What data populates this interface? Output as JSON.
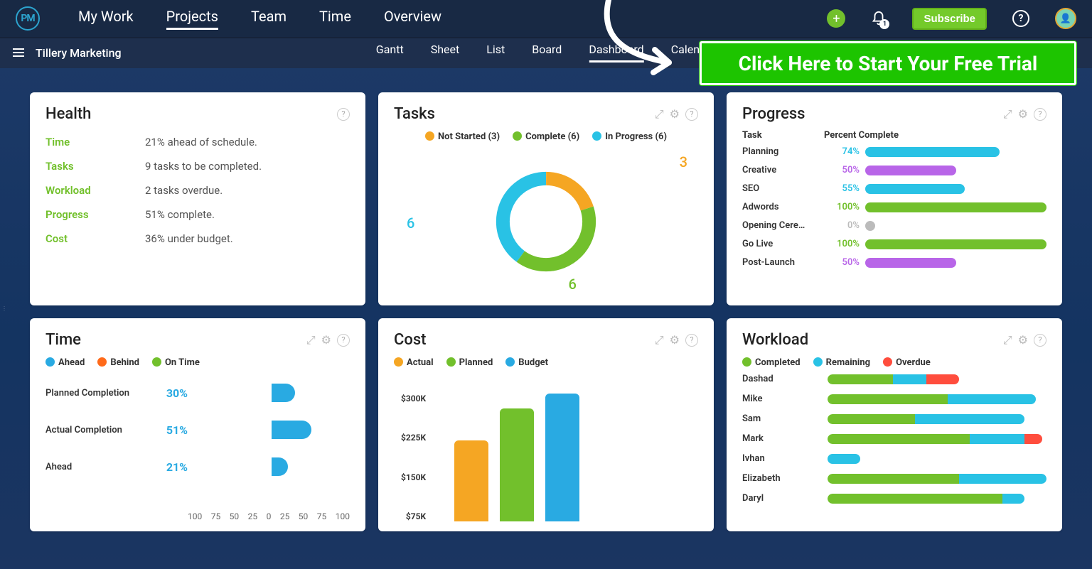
{
  "nav": {
    "logo": "PM",
    "items": [
      "My Work",
      "Projects",
      "Team",
      "Time",
      "Overview"
    ],
    "active_index": 1,
    "subscribe_label": "Subscribe",
    "bell_count": "1"
  },
  "project": {
    "name": "Tillery Marketing"
  },
  "view_tabs": {
    "items": [
      "Gantt",
      "Sheet",
      "List",
      "Board",
      "Dashboard",
      "Calendar"
    ],
    "active_index": 4
  },
  "cta": {
    "label": "Click Here to Start Your Free Trial"
  },
  "cards": {
    "health": {
      "title": "Health",
      "rows": [
        {
          "label": "Time",
          "value": "21% ahead of schedule."
        },
        {
          "label": "Tasks",
          "value": "9 tasks to be completed."
        },
        {
          "label": "Workload",
          "value": "2 tasks overdue."
        },
        {
          "label": "Progress",
          "value": "51% complete."
        },
        {
          "label": "Cost",
          "value": "36% under budget."
        }
      ]
    },
    "tasks": {
      "title": "Tasks",
      "legend": [
        {
          "label": "Not Started (3)",
          "color": "#f5a623",
          "count": 3
        },
        {
          "label": "Complete (6)",
          "color": "#72c02c",
          "count": 6
        },
        {
          "label": "In Progress (6)",
          "color": "#29c2e5",
          "count": 6
        }
      ],
      "donut_labels": {
        "top": "3",
        "bottom": "6",
        "left": "6"
      }
    },
    "progress": {
      "title": "Progress",
      "header_task": "Task",
      "header_pct": "Percent Complete",
      "rows": [
        {
          "task": "Planning",
          "pct": "74%",
          "pctn": 74,
          "color": "#29c2e5"
        },
        {
          "task": "Creative",
          "pct": "50%",
          "pctn": 50,
          "color": "#b865e8"
        },
        {
          "task": "SEO",
          "pct": "55%",
          "pctn": 55,
          "color": "#29c2e5"
        },
        {
          "task": "Adwords",
          "pct": "100%",
          "pctn": 100,
          "color": "#72c02c"
        },
        {
          "task": "Opening Cere…",
          "pct": "0%",
          "pctn": 0,
          "color": "#bbbbbb"
        },
        {
          "task": "Go Live",
          "pct": "100%",
          "pctn": 100,
          "color": "#72c02c"
        },
        {
          "task": "Post-Launch",
          "pct": "50%",
          "pctn": 50,
          "color": "#b865e8"
        }
      ]
    },
    "time": {
      "title": "Time",
      "legend": [
        {
          "label": "Ahead",
          "color": "#29aae2"
        },
        {
          "label": "Behind",
          "color": "#ff6a1a"
        },
        {
          "label": "On Time",
          "color": "#72c02c"
        }
      ],
      "rows": [
        {
          "label": "Planned Completion",
          "value": "30%",
          "n": 30
        },
        {
          "label": "Actual Completion",
          "value": "51%",
          "n": 51
        },
        {
          "label": "Ahead",
          "value": "21%",
          "n": 21
        }
      ],
      "xaxis": [
        "100",
        "75",
        "50",
        "25",
        "0",
        "25",
        "50",
        "75",
        "100"
      ]
    },
    "cost": {
      "title": "Cost",
      "legend": [
        {
          "label": "Actual",
          "color": "#f5a623"
        },
        {
          "label": "Planned",
          "color": "#72c02c"
        },
        {
          "label": "Budget",
          "color": "#29aae2"
        }
      ],
      "ylabels": [
        "$300K",
        "$225K",
        "$150K",
        "$75K"
      ],
      "bars": [
        {
          "name": "Actual",
          "value": 190,
          "color": "#f5a623"
        },
        {
          "name": "Planned",
          "value": 265,
          "color": "#72c02c"
        },
        {
          "name": "Budget",
          "value": 300,
          "color": "#29aae2"
        }
      ],
      "ymax": 300
    },
    "workload": {
      "title": "Workload",
      "legend": [
        {
          "label": "Completed",
          "color": "#72c02c"
        },
        {
          "label": "Remaining",
          "color": "#29c2e5"
        },
        {
          "label": "Overdue",
          "color": "#ff4d3d"
        }
      ],
      "rows": [
        {
          "name": "Dashad",
          "seg": [
            30,
            15,
            15
          ],
          "total": 100
        },
        {
          "name": "Mike",
          "seg": [
            55,
            40,
            0
          ],
          "total": 100
        },
        {
          "name": "Sam",
          "seg": [
            40,
            50,
            0
          ],
          "total": 100
        },
        {
          "name": "Mark",
          "seg": [
            65,
            25,
            8
          ],
          "total": 100
        },
        {
          "name": "Ivhan",
          "seg": [
            0,
            15,
            0
          ],
          "total": 100
        },
        {
          "name": "Elizabeth",
          "seg": [
            60,
            40,
            0
          ],
          "total": 100
        },
        {
          "name": "Daryl",
          "seg": [
            80,
            10,
            0
          ],
          "total": 100
        }
      ]
    }
  },
  "chart_data": [
    {
      "type": "pie",
      "title": "Tasks",
      "series": [
        {
          "name": "Not Started",
          "value": 3
        },
        {
          "name": "Complete",
          "value": 6
        },
        {
          "name": "In Progress",
          "value": 6
        }
      ]
    },
    {
      "type": "bar",
      "title": "Progress — Percent Complete",
      "categories": [
        "Planning",
        "Creative",
        "SEO",
        "Adwords",
        "Opening Ceremony",
        "Go Live",
        "Post-Launch"
      ],
      "values": [
        74,
        50,
        55,
        100,
        0,
        100,
        50
      ],
      "xlabel": "Task",
      "ylabel": "Percent Complete",
      "ylim": [
        0,
        100
      ]
    },
    {
      "type": "bar",
      "title": "Time",
      "categories": [
        "Planned Completion",
        "Actual Completion",
        "Ahead"
      ],
      "values": [
        30,
        51,
        21
      ],
      "xlabel": "",
      "ylabel": "%",
      "ylim": [
        -100,
        100
      ]
    },
    {
      "type": "bar",
      "title": "Cost",
      "categories": [
        "Actual",
        "Planned",
        "Budget"
      ],
      "values": [
        190,
        265,
        300
      ],
      "xlabel": "",
      "ylabel": "$K",
      "ylim": [
        0,
        300
      ]
    },
    {
      "type": "bar",
      "title": "Workload",
      "categories": [
        "Dashad",
        "Mike",
        "Sam",
        "Mark",
        "Ivhan",
        "Elizabeth",
        "Daryl"
      ],
      "series": [
        {
          "name": "Completed",
          "values": [
            30,
            55,
            40,
            65,
            0,
            60,
            80
          ]
        },
        {
          "name": "Remaining",
          "values": [
            15,
            40,
            50,
            25,
            15,
            40,
            10
          ]
        },
        {
          "name": "Overdue",
          "values": [
            15,
            0,
            0,
            8,
            0,
            0,
            0
          ]
        }
      ]
    }
  ]
}
